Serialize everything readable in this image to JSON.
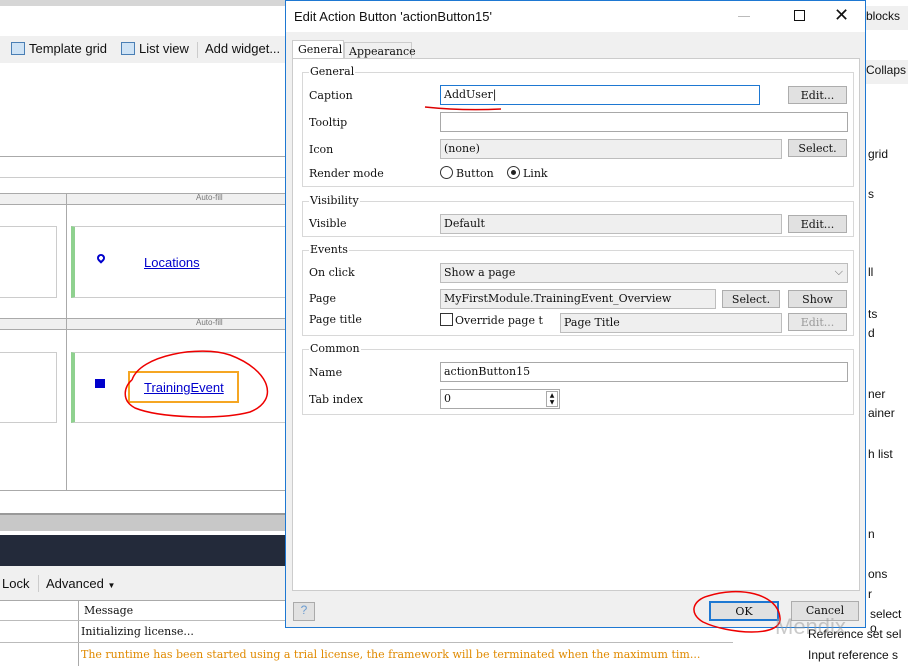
{
  "toolbar": {
    "items": [
      {
        "label": "Template grid",
        "icon": "template-grid-icon"
      },
      {
        "label": "List view",
        "icon": "list-view-icon"
      },
      {
        "label": "Add widget..."
      }
    ]
  },
  "canvas": {
    "autofill_label": "Auto-fill",
    "links": [
      {
        "label": "Locations",
        "icon": "map-marker-icon"
      },
      {
        "label": "TrainingEvent",
        "icon": "calendar-icon"
      }
    ],
    "link_color": "#0000cc",
    "highlight_color": "#f5a623"
  },
  "bottom": {
    "toolbar": {
      "lock": "Lock",
      "advanced": "Advanced"
    },
    "table": {
      "header": "Message",
      "rows": [
        "Initializing license...",
        "The runtime has been started using a trial license, the framework will be terminated when the maximum tim..."
      ]
    },
    "warning_color": "#e08a00"
  },
  "sidebar": {
    "items": [
      "blocks",
      "Collaps",
      "grid",
      "s",
      "ll",
      "ts",
      "d",
      "ner",
      "ainer",
      "h list",
      "n",
      "ons",
      "r",
      "selecto",
      "Reference set sel",
      "Input reference s"
    ]
  },
  "dialog": {
    "title": "Edit Action Button 'actionButton15'",
    "tabs": [
      "General",
      "Appearance"
    ],
    "general": {
      "legend": "General",
      "caption_label": "Caption",
      "caption_value": "AddUser",
      "edit": "Edit...",
      "tooltip_label": "Tooltip",
      "tooltip_value": "",
      "icon_label": "Icon",
      "icon_value": "(none)",
      "select": "Select.",
      "render_label": "Render mode",
      "render_options": [
        "Button",
        "Link"
      ],
      "render_selected": "Link"
    },
    "visibility": {
      "legend": "Visibility",
      "visible_label": "Visible",
      "visible_value": "Default",
      "edit": "Edit..."
    },
    "events": {
      "legend": "Events",
      "onclick_label": "On click",
      "onclick_value": "Show a page",
      "page_label": "Page",
      "page_value": "MyFirstModule.TrainingEvent_Overview",
      "select": "Select.",
      "show": "Show",
      "title_label": "Page title",
      "override_label": "Override page t",
      "override_checked": false,
      "title_value": "Page Title",
      "edit": "Edit..."
    },
    "common": {
      "legend": "Common",
      "name_label": "Name",
      "name_value": "actionButton15",
      "tab_label": "Tab index",
      "tab_value": "0"
    },
    "ok": "OK",
    "cancel": "Cancel"
  },
  "watermark": "Mendix"
}
